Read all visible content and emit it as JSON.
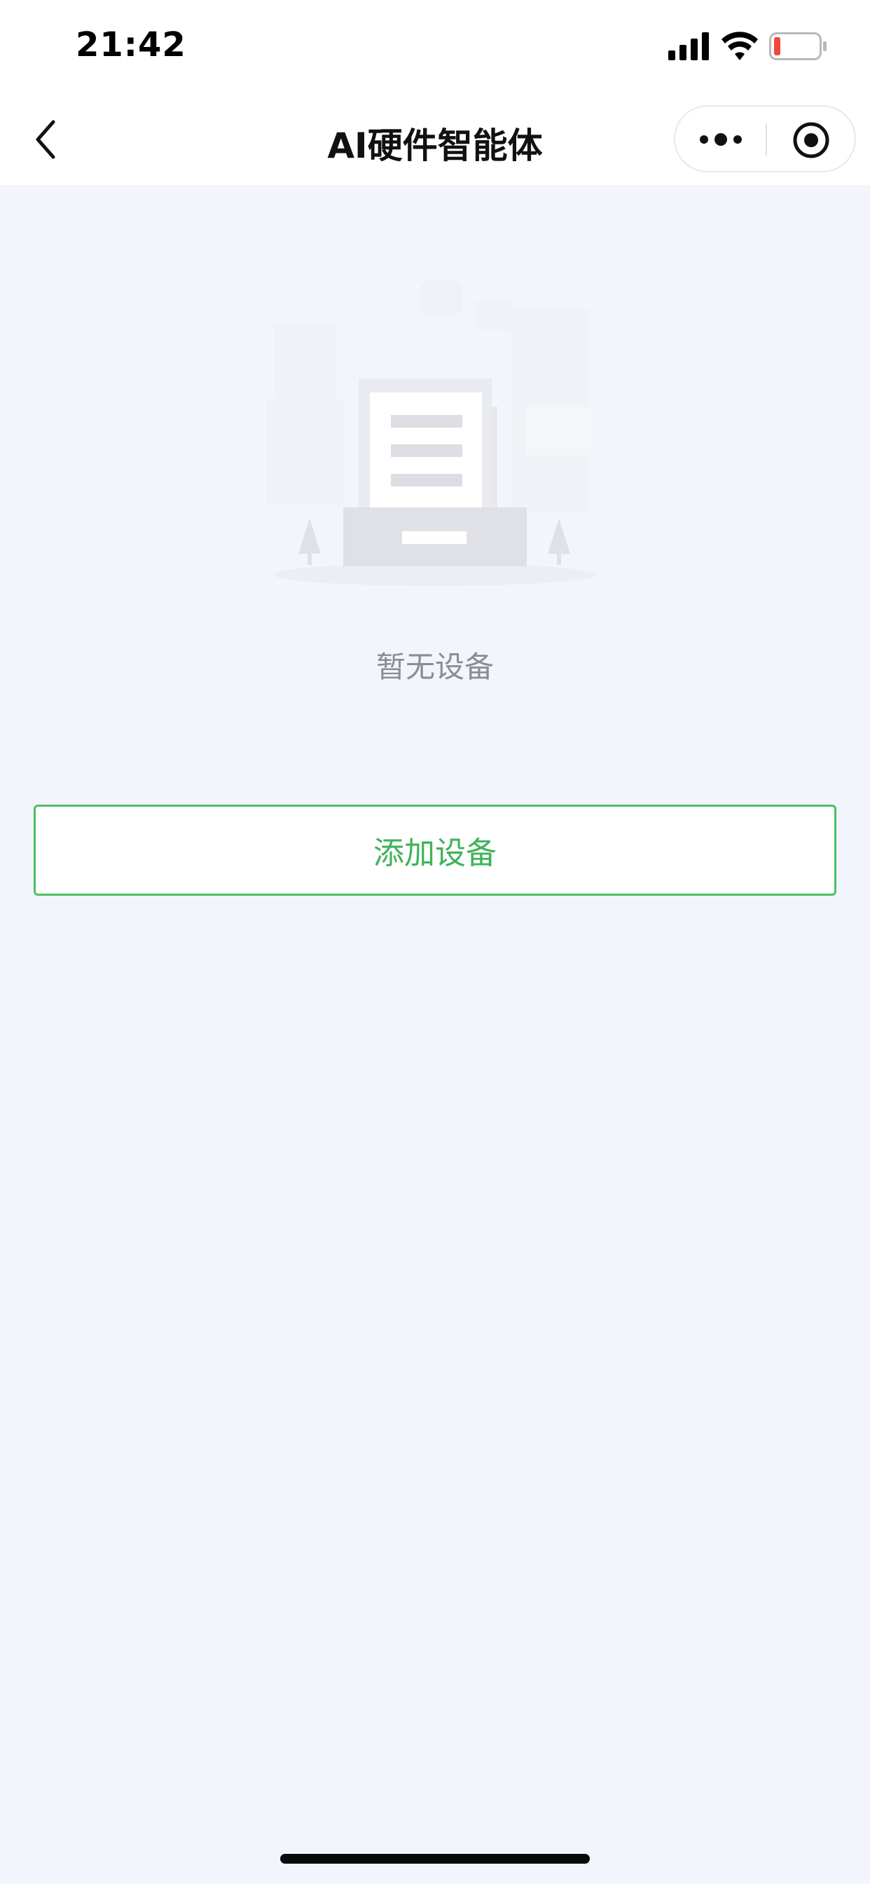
{
  "status_bar": {
    "time": "21:42",
    "signal_icon": "cellular-signal-icon",
    "wifi_icon": "wifi-icon",
    "battery_icon": "battery-low-icon",
    "battery_color": "#f0483e"
  },
  "nav_bar": {
    "back_icon": "chevron-left-icon",
    "title": "AI硬件智能体",
    "more_icon": "more-dots-icon",
    "close_icon": "mini-program-close-icon"
  },
  "empty_state": {
    "illustration": "empty-devices-illustration",
    "message": "暂无设备"
  },
  "actions": {
    "add_device_label": "添加设备",
    "accent_color": "#4cbf64"
  },
  "colors": {
    "background": "#f2f5fc",
    "header": "#ffffff",
    "muted_text": "#8a8d94"
  }
}
